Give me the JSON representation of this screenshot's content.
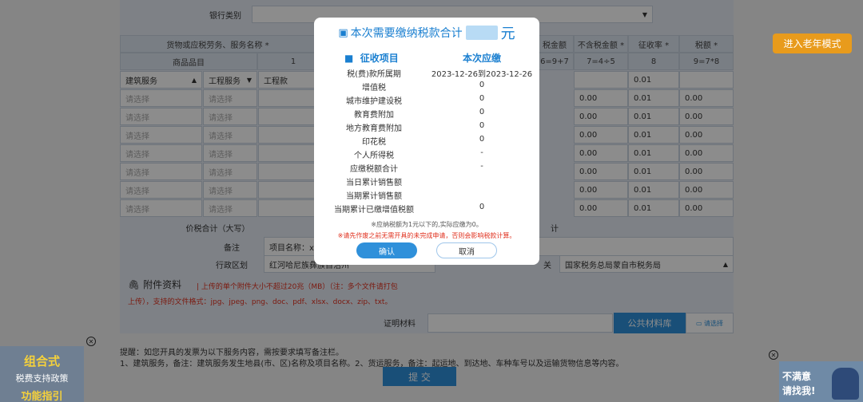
{
  "form": {
    "bank_type_label": "银行类别",
    "table_headers": {
      "goods_service": "货物或应税劳务、服务名称 *",
      "tax_amount": "税金额",
      "no_tax_amount": "不含税金额 *",
      "rate": "征收率 *",
      "tax": "税额 *"
    },
    "subheaders": {
      "item": "商品品目",
      "col1": "1",
      "formula1": "6=9+7",
      "formula2": "7=4÷5",
      "col8": "8",
      "formula3": "9=7*8"
    },
    "first_row": {
      "cat1": "建筑服务",
      "cat2": "工程服务",
      "cat3": "工程款",
      "rate": "0.01"
    },
    "placeholder": "请选择",
    "row_values": {
      "no_tax": "0.00",
      "rate": "0.01",
      "tax": "0.00"
    },
    "total_label": "价税合计（大写）",
    "total_right": "计",
    "remark_label": "备注",
    "remark_value": "项目名称：x",
    "region_label": "行政区划",
    "region_value": "红河哈尼族彝族自治州",
    "tax_office_label": "关",
    "tax_office_value": "国家税务总局蒙自市税务局",
    "attach_title": "附件资料",
    "attach_desc1": "| 上传的单个附件大小不超过20兆（MB）（注：多个文件请打包",
    "attach_desc2": "上传），支持的文件格式：jpg、jpeg、png、doc、pdf、xlsx、docx、zip、txt。",
    "proof_label": "证明材料",
    "public_lib": "公共材料库",
    "choose_btn": "请选择",
    "tip1": "提醒：如您开具的发票为以下服务内容，需按要求填写备注栏。",
    "tip2": "1、建筑服务，备注：建筑服务发生地县(市、区)名称及项目名称。2、货运服务，备注：起运地、到达地、车种车号以及运输货物信息等内容。",
    "submit": "提 交"
  },
  "elder_mode": "进入老年模式",
  "modal": {
    "title": "本次需要缴纳税款合计",
    "unit": "元",
    "col_item": "征收项目",
    "col_due": "本次应缴",
    "rows": [
      {
        "k": "税(费)款所属期",
        "v": "2023-12-26到2023-12-26"
      },
      {
        "k": "增值税",
        "v": "0"
      },
      {
        "k": "城市维护建设税",
        "v": "0"
      },
      {
        "k": "教育费附加",
        "v": "0"
      },
      {
        "k": "地方教育费附加",
        "v": "0"
      },
      {
        "k": "印花税",
        "v": "0"
      },
      {
        "k": "个人所得税",
        "v": "-"
      },
      {
        "k": "应缴税额合计",
        "v": "-"
      },
      {
        "k": "当日累计销售额",
        "v": ""
      },
      {
        "k": "当期累计销售额",
        "v": ""
      },
      {
        "k": "当期累计已缴增值税额",
        "v": "0"
      }
    ],
    "note1": "※应纳税额为1元以下的,实际应缴为0。",
    "note2": "※请先作废之前无需开具的未完成申请，否则会影响税款计算。",
    "ok": "确认",
    "cancel": "取消"
  },
  "banner_left": {
    "line1": "组合式",
    "line2": "税费支持政策",
    "line3": "功能指引"
  },
  "banner_right": {
    "line1": "不满意",
    "line2": "请找我!"
  }
}
